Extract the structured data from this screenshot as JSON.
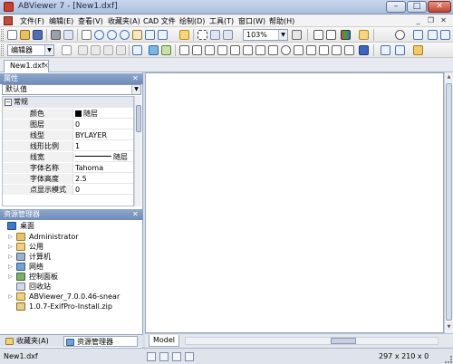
{
  "window": {
    "title": "ABViewer 7 - [New1.dxf]",
    "min_label": "–",
    "max_label": "□",
    "close_label": "✕"
  },
  "menu": {
    "items": [
      "文件(F)",
      "编辑(E)",
      "查看(V)",
      "收藏夹(A)",
      "CAD 文件",
      "绘制(D)",
      "工具(T)",
      "窗口(W)",
      "帮助(H)"
    ],
    "mdi_min": "_",
    "mdi_restore": "❐",
    "mdi_close": "✕"
  },
  "toolbar": {
    "zoom_value": "103%",
    "editor_combo": "编辑器",
    "combo_arrow": "▼"
  },
  "document_tab": {
    "label": "New1.dxf",
    "close": "✕"
  },
  "properties": {
    "header": "属性",
    "close": "✕",
    "selector": "默认值",
    "group": "常规",
    "group_toggle": "−",
    "rows": [
      {
        "name": "颜色",
        "value": "随层"
      },
      {
        "name": "图层",
        "value": "0"
      },
      {
        "name": "线型",
        "value": "BYLAYER"
      },
      {
        "name": "线形比例",
        "value": "1"
      },
      {
        "name": "线宽",
        "value": "随层"
      },
      {
        "name": "字体名称",
        "value": "Tahoma"
      },
      {
        "name": "字体高度",
        "value": "2.5"
      },
      {
        "name": "点显示模式",
        "value": "0"
      }
    ]
  },
  "explorer": {
    "header": "资源管理器",
    "close": "✕",
    "nodes": [
      {
        "label": "桌面",
        "icon": "desktop-icon"
      },
      {
        "label": "Administrator",
        "icon": "user-folder-icon"
      },
      {
        "label": "公用",
        "icon": "folder-icon"
      },
      {
        "label": "计算机",
        "icon": "computer-icon"
      },
      {
        "label": "网络",
        "icon": "network-icon"
      },
      {
        "label": "控制面板",
        "icon": "control-panel-icon"
      },
      {
        "label": "回收站",
        "icon": "recycle-bin-icon"
      },
      {
        "label": "ABViewer_7.0.0.46-snear",
        "icon": "folder-icon"
      },
      {
        "label": "1.0.7-ExifPro-Install.zip",
        "icon": "zip-icon"
      }
    ]
  },
  "bottom_tabs": {
    "favorites": "收藏夹(A)",
    "explorer": "资源管理器"
  },
  "model_tab": "Model",
  "status": {
    "file": "New1.dxf",
    "size": "297 x 210 x 0"
  },
  "colors": {
    "accent": "#6f8bb8",
    "title_gradient_top": "#c9d6ea",
    "close_red": "#c4422c"
  }
}
